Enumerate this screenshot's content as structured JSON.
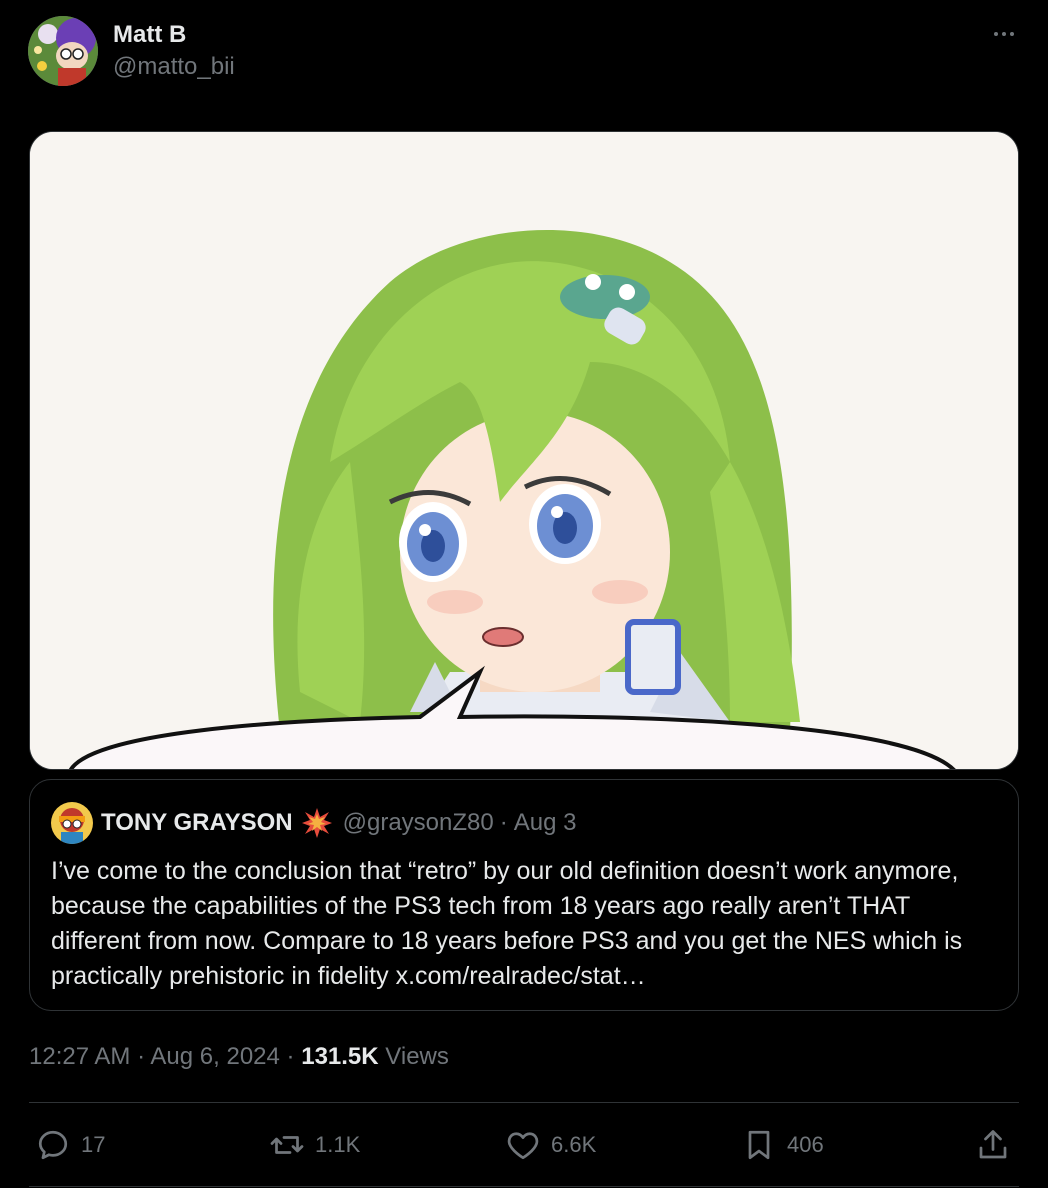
{
  "author": {
    "display_name": "Matt B",
    "handle": "@matto_bii",
    "avatar_icon": "avatar-icon"
  },
  "more_icon": "more-horizontal-icon",
  "media": {
    "icon": "anime-girl-image"
  },
  "quote": {
    "display_name": "TONY GRAYSON",
    "badge_icon": "explosion-emoji-icon",
    "handle": "@graysonZ80",
    "separator": "·",
    "date": "Aug 3",
    "text": "I’ve come to the conclusion that “retro” by our old definition doesn’t work anymore, because the capabilities of the PS3 tech from 18 years ago really aren’t THAT different from now. Compare to 18 years before PS3 and you get the NES which is practically prehistoric in fidelity x.com/realradec/stat…"
  },
  "meta": {
    "time": "12:27 AM",
    "sep1": "·",
    "date": "Aug 6, 2024",
    "sep2": "·",
    "views_count": "131.5K",
    "views_label": "Views"
  },
  "actions": {
    "reply_count": "17",
    "repost_count": "1.1K",
    "like_count": "6.6K",
    "bookmark_count": "406"
  },
  "colors": {
    "background": "#000000",
    "text_primary": "#e7e9ea",
    "text_secondary": "#71767b",
    "border": "#2f3336"
  }
}
